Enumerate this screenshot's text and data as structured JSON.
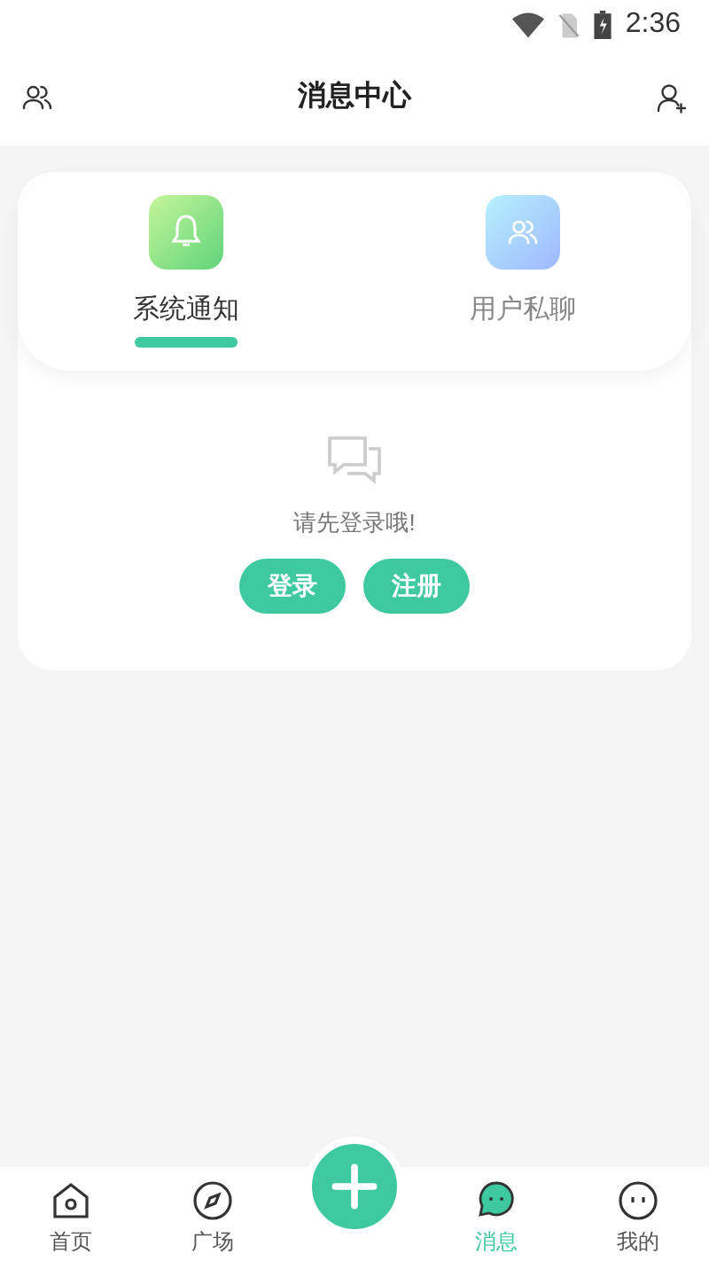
{
  "status_bar": {
    "time": "2:36"
  },
  "header": {
    "title": "消息中心"
  },
  "tabs": [
    {
      "label": "系统通知",
      "kind": "notice",
      "selected": true
    },
    {
      "label": "用户私聊",
      "kind": "chat",
      "selected": false
    }
  ],
  "empty_state": {
    "message": "请先登录哦!",
    "buttons": [
      "登录",
      "注册"
    ]
  },
  "bottom_nav": [
    {
      "label": "首页",
      "kind": "home",
      "selected": false
    },
    {
      "label": "广场",
      "kind": "compass",
      "selected": false
    },
    {
      "kind": "add"
    },
    {
      "label": "消息",
      "kind": "message",
      "selected": true
    },
    {
      "label": "我的",
      "kind": "me",
      "selected": false
    }
  ]
}
